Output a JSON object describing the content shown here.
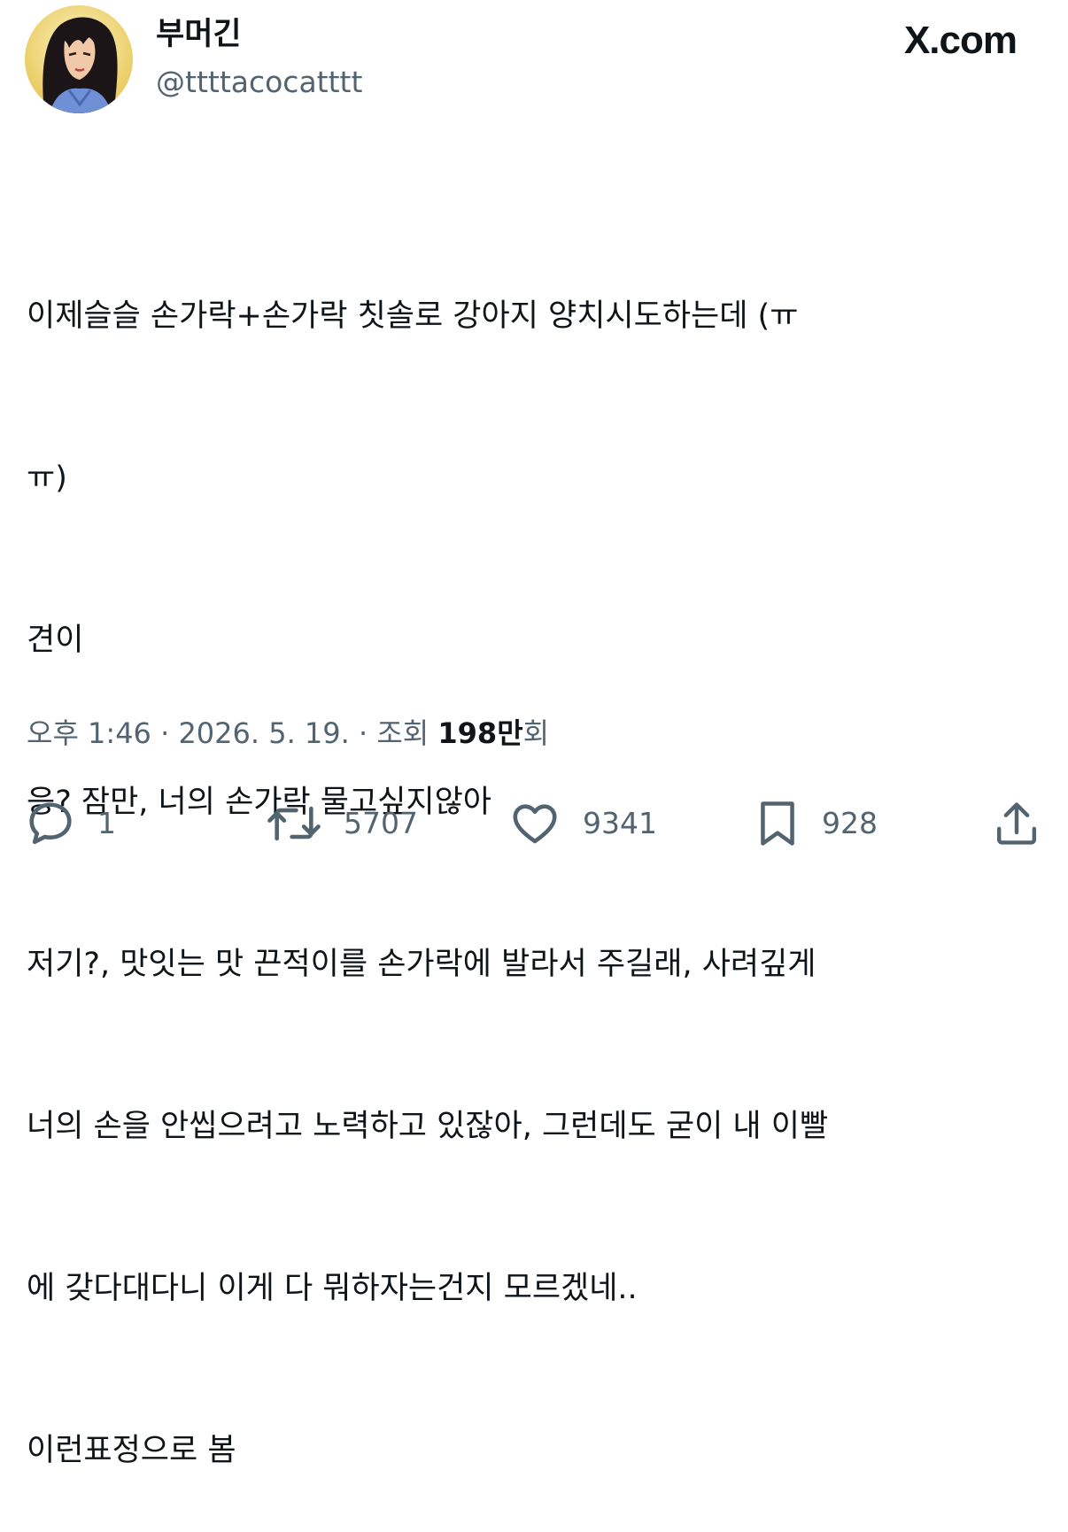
{
  "author": {
    "display_name": "부머긴",
    "handle": "@ttttacocatttt"
  },
  "brand": "X.com",
  "tweet": {
    "lines": [
      "이제슬슬 손가락+손가락 칫솔로 강아지 양치시도하는데 (ㅠ",
      "ㅠ)",
      "견이",
      "응? 잠만, 너의 손가락 물고싶지않아",
      "저기?, 맛잇는 맛 끈적이를 손가락에 발라서 주길래, 사려깊게",
      "너의 손을 안씹으려고 노력하고 있잖아, 그런데도 굳이 내 이빨",
      "에 갖다대다니 이게 다 뭐하자는건지 모르겠네..",
      "이런표정으로 봄"
    ]
  },
  "meta": {
    "time": "오후 1:46",
    "separator": " · ",
    "date": "2026. 5. 19.",
    "views_label": "조회",
    "views_count": "198만",
    "views_suffix": "회"
  },
  "actions": {
    "reply": {
      "icon": "reply-icon",
      "count": "1"
    },
    "retweet": {
      "icon": "retweet-icon",
      "count": "5707"
    },
    "like": {
      "icon": "heart-icon",
      "count": "9341"
    },
    "bookmark": {
      "icon": "bookmark-icon",
      "count": "928"
    },
    "share": {
      "icon": "share-icon"
    }
  },
  "colors": {
    "text": "#0f1419",
    "secondary": "#536471",
    "background": "#ffffff"
  }
}
